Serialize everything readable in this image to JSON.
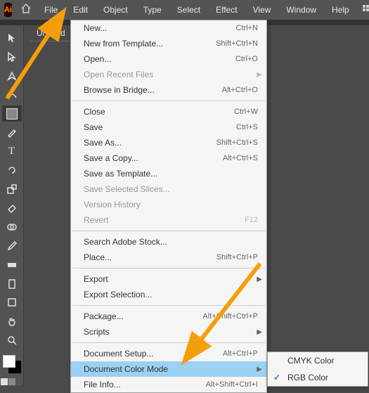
{
  "app": {
    "logo_text": "Ai"
  },
  "menubar": {
    "items": [
      "File",
      "Edit",
      "Object",
      "Type",
      "Select",
      "Effect",
      "View",
      "Window",
      "Help"
    ]
  },
  "document": {
    "tab_title": "Untitled"
  },
  "file_menu": {
    "groups": [
      [
        {
          "label": "New...",
          "shortcut": "Ctrl+N",
          "disabled": false
        },
        {
          "label": "New from Template...",
          "shortcut": "Shift+Ctrl+N",
          "disabled": false
        },
        {
          "label": "Open...",
          "shortcut": "Ctrl+O",
          "disabled": false
        },
        {
          "label": "Open Recent Files",
          "shortcut": "",
          "disabled": true,
          "submenu": true
        },
        {
          "label": "Browse in Bridge...",
          "shortcut": "Alt+Ctrl+O",
          "disabled": false
        }
      ],
      [
        {
          "label": "Close",
          "shortcut": "Ctrl+W",
          "disabled": false
        },
        {
          "label": "Save",
          "shortcut": "Ctrl+S",
          "disabled": false
        },
        {
          "label": "Save As...",
          "shortcut": "Shift+Ctrl+S",
          "disabled": false
        },
        {
          "label": "Save a Copy...",
          "shortcut": "Alt+Ctrl+S",
          "disabled": false
        },
        {
          "label": "Save as Template...",
          "shortcut": "",
          "disabled": false
        },
        {
          "label": "Save Selected Slices...",
          "shortcut": "",
          "disabled": true
        },
        {
          "label": "Version History",
          "shortcut": "",
          "disabled": true
        },
        {
          "label": "Revert",
          "shortcut": "F12",
          "disabled": true
        }
      ],
      [
        {
          "label": "Search Adobe Stock...",
          "shortcut": "",
          "disabled": false
        },
        {
          "label": "Place...",
          "shortcut": "Shift+Ctrl+P",
          "disabled": false
        }
      ],
      [
        {
          "label": "Export",
          "shortcut": "",
          "disabled": false,
          "submenu": true
        },
        {
          "label": "Export Selection...",
          "shortcut": "",
          "disabled": false
        }
      ],
      [
        {
          "label": "Package...",
          "shortcut": "Alt+Shift+Ctrl+P",
          "disabled": false
        },
        {
          "label": "Scripts",
          "shortcut": "",
          "disabled": false,
          "submenu": true
        }
      ],
      [
        {
          "label": "Document Setup...",
          "shortcut": "Alt+Ctrl+P",
          "disabled": false
        },
        {
          "label": "Document Color Mode",
          "shortcut": "",
          "disabled": false,
          "submenu": true,
          "highlighted": true
        },
        {
          "label": "File Info...",
          "shortcut": "Alt+Shift+Ctrl+I",
          "disabled": false
        }
      ]
    ]
  },
  "color_mode_submenu": {
    "items": [
      {
        "label": "CMYK Color",
        "checked": false
      },
      {
        "label": "RGB Color",
        "checked": true
      }
    ]
  },
  "tools": [
    "selection",
    "direct-selection",
    "pen",
    "curvature",
    "rectangle",
    "paintbrush",
    "type",
    "rotate",
    "scale",
    "eraser",
    "noop1",
    "eyedropper",
    "gradient",
    "noop2",
    "artboard",
    "hand",
    "zoom"
  ]
}
